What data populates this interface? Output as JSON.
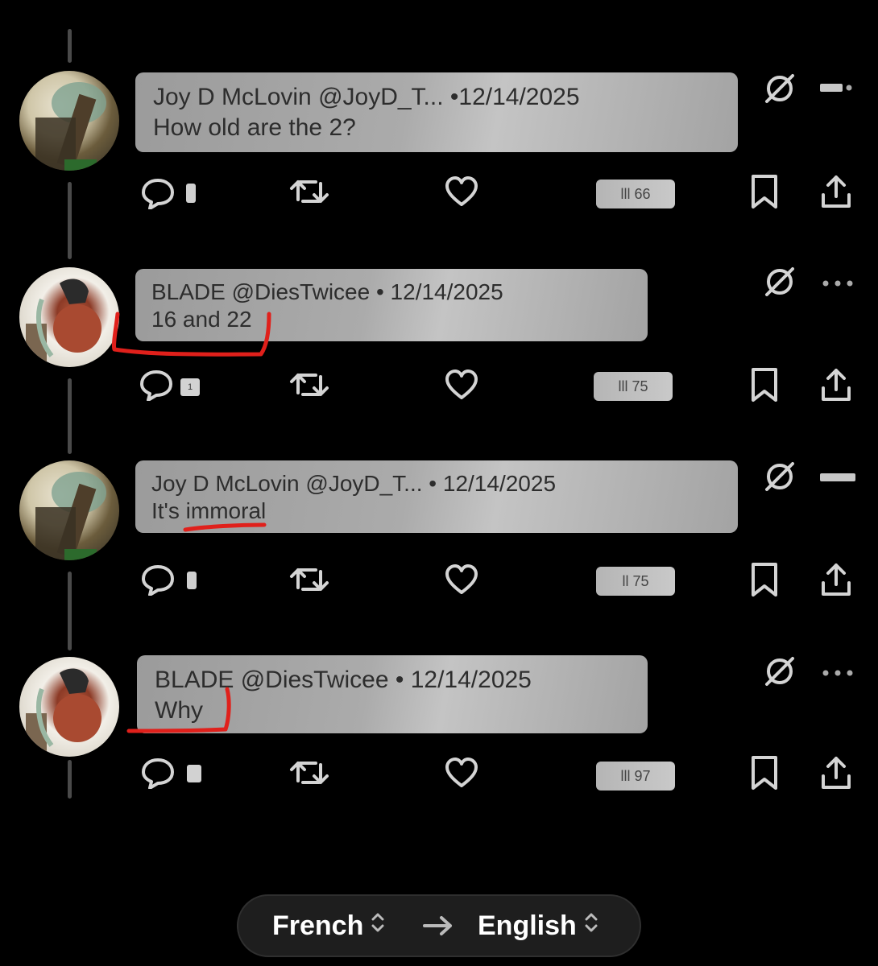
{
  "posts": [
    {
      "meta": "Joy D McLovin @JoyD_T... •12/14/2025",
      "text": "How old are the 2?",
      "views": "lll 66",
      "reply_count": ""
    },
    {
      "meta": "BLADE @DiesTwicee • 12/14/2025",
      "text": "16 and 22",
      "views": "lll 75",
      "reply_count": "1"
    },
    {
      "meta": "Joy D McLovin @JoyD_T... • 12/14/2025",
      "text": "It's immoral",
      "views": "ll 75",
      "reply_count": ""
    },
    {
      "meta": "BLADE @DiesTwicee • 12/14/2025",
      "text": "Why",
      "views": "lll 97",
      "reply_count": ""
    }
  ],
  "translate": {
    "source": "French",
    "target": "English"
  },
  "colors": {
    "background": "#000000",
    "icon": "#d4d4d4",
    "annotation": "#e0201b"
  }
}
